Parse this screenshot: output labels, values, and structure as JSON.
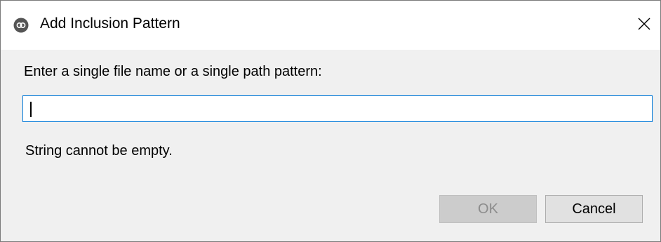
{
  "window": {
    "title": "Add Inclusion Pattern",
    "icon": "app-logo-icon",
    "close_icon": "close-icon"
  },
  "form": {
    "prompt": "Enter a single file name or a single path pattern:",
    "pattern_value": "",
    "validation_message": "String cannot be empty."
  },
  "buttons": {
    "ok_label": "OK",
    "ok_enabled": false,
    "cancel_label": "Cancel"
  },
  "colors": {
    "focus_border": "#0078d7",
    "dialog_background": "#f0f0f0",
    "disabled_text": "#8c8c8c"
  }
}
